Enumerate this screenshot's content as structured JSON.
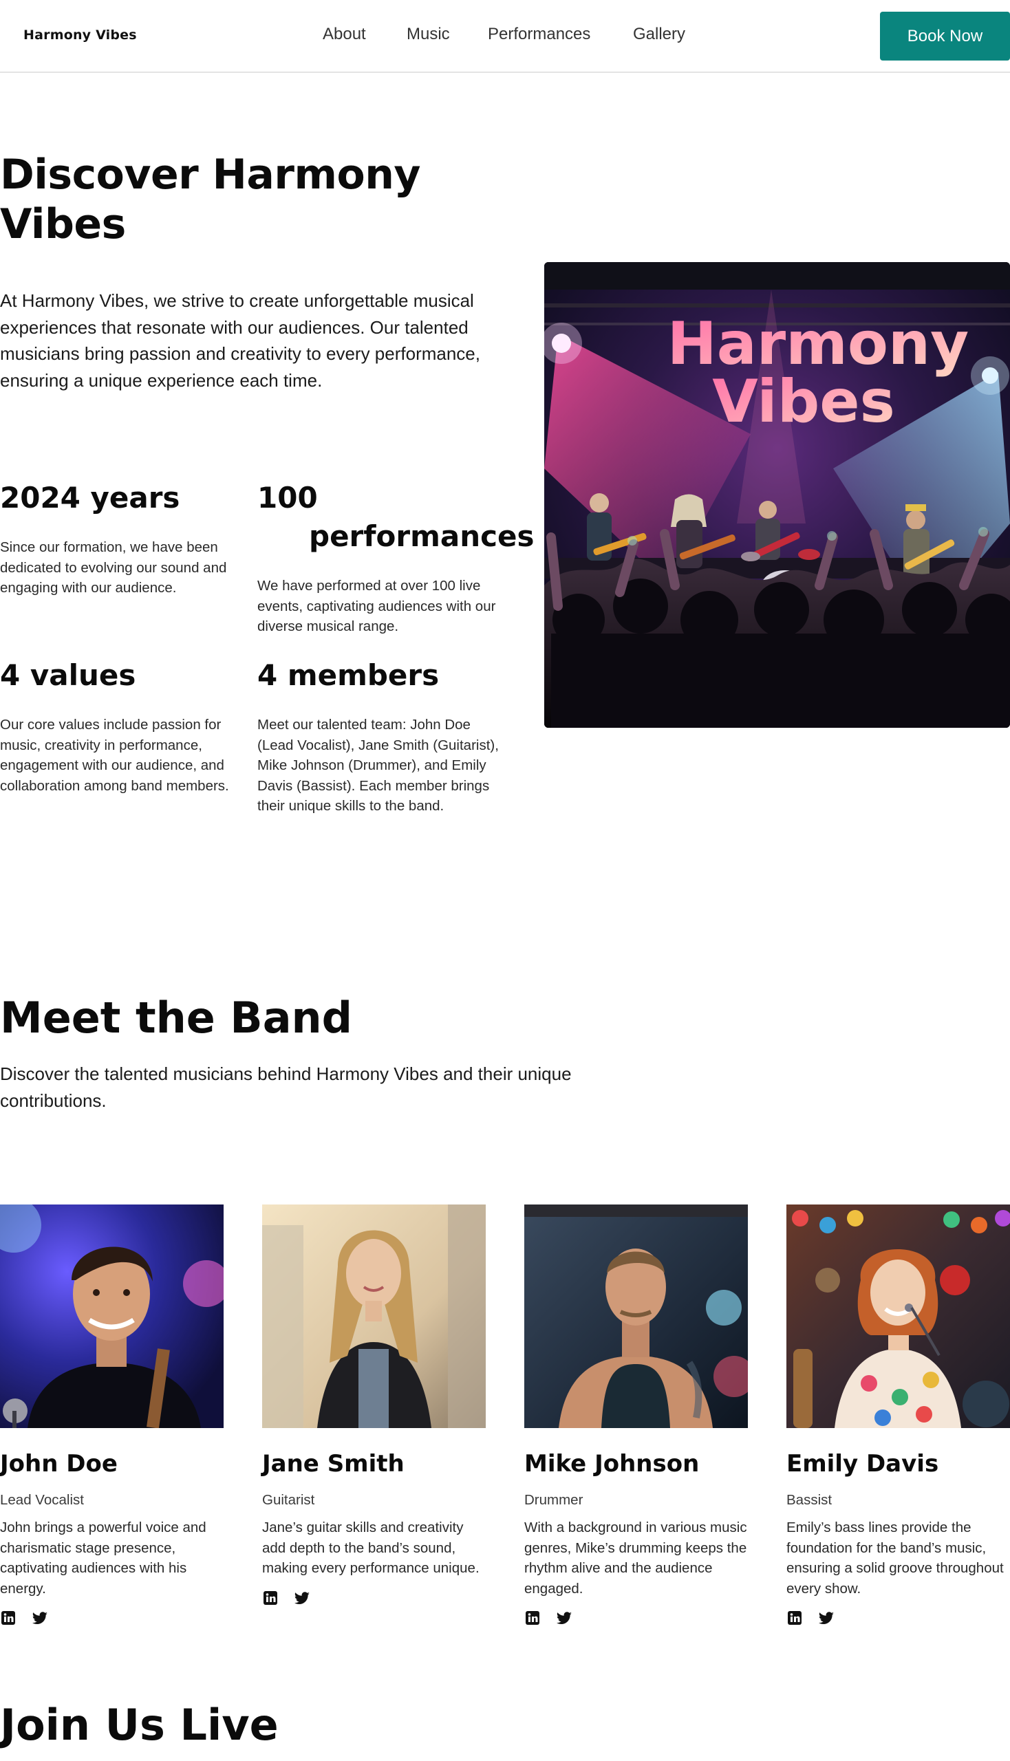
{
  "nav": {
    "brand": "Harmony Vibes",
    "links": [
      "About",
      "Music",
      "Performances",
      "Gallery"
    ],
    "cta": "Book Now"
  },
  "hero": {
    "title": "Discover Harmony Vibes",
    "text": "At Harmony Vibes, we strive to create unforgettable musical experiences that resonate with our audiences. Our talented musicians bring passion and creativity to every performance, ensuring a unique experience each time.",
    "image_sign": [
      "Harmony",
      "Vibes"
    ]
  },
  "stats": [
    {
      "title": "2024 years",
      "text": "Since our formation, we have been dedicated to evolving our sound and engaging with our audience."
    },
    {
      "title_line1": "100",
      "title_line2": "performances",
      "text": "We have performed at over 100 live events, captivating audiences with our diverse musical range."
    },
    {
      "title": "4 values",
      "text": "Our core values include passion for music, creativity in performance, engagement with our audience, and collaboration among band members."
    },
    {
      "title": "4 members",
      "text": "Meet our talented team: John Doe (Lead Vocalist), Jane Smith (Guitarist), Mike Johnson (Drummer), and Emily Davis (Bassist). Each member brings their unique skills to the band."
    }
  ],
  "band": {
    "title": "Meet the Band",
    "subtitle": "Discover the talented musicians behind Harmony Vibes and their unique contributions.",
    "members": [
      {
        "name": "John Doe",
        "role": "Lead Vocalist",
        "bio": "John brings a powerful voice and charismatic stage presence, captivating audiences with his energy."
      },
      {
        "name": "Jane Smith",
        "role": "Guitarist",
        "bio": "Jane’s guitar skills and creativity add depth to the band’s sound, making every performance unique."
      },
      {
        "name": "Mike Johnson",
        "role": "Drummer",
        "bio": "With a background in various music genres, Mike’s drumming keeps the rhythm alive and the audience engaged."
      },
      {
        "name": "Emily Davis",
        "role": "Bassist",
        "bio": "Emily’s bass lines provide the foundation for the band’s music, ensuring a solid groove throughout every show."
      }
    ]
  },
  "join": {
    "title": "Join Us Live"
  },
  "colors": {
    "accent": "#0a857e",
    "text": "#0b0b0b",
    "muted": "#2a2a2a",
    "divider": "#e4e4e4"
  },
  "icons": [
    "linkedin-icon",
    "twitter-icon"
  ]
}
